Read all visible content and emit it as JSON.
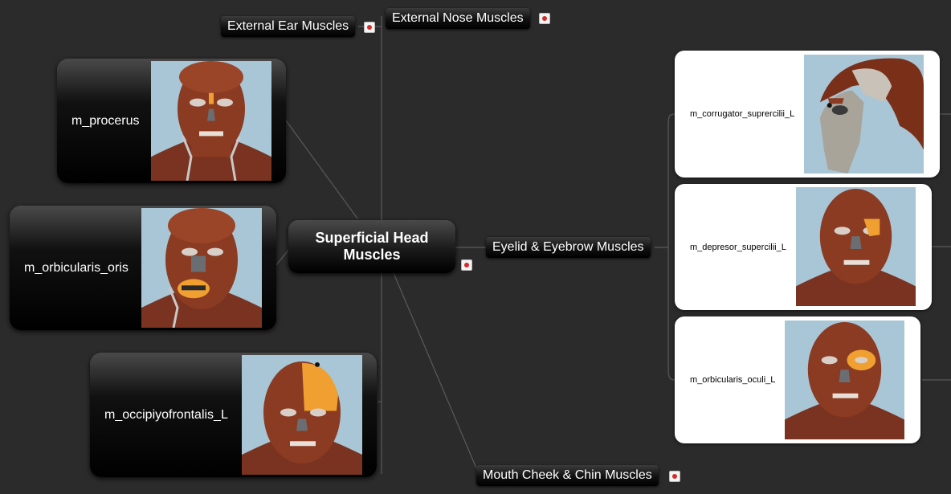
{
  "map": {
    "central_topic": "Superficial Head\nMuscles",
    "topics": {
      "external_ear": "External Ear Muscles",
      "external_nose": "External Nose Muscles",
      "eyelid_eyebrow": "Eyelid & Eyebrow Muscles",
      "mouth_cheek_chin": "Mouth Cheek & Chin Muscles"
    },
    "left_cards": [
      {
        "label": "m_procerus",
        "highlight": "nose-bridge"
      },
      {
        "label": "m_orbicularis_oris",
        "highlight": "lips"
      },
      {
        "label": "m_occipiyofrontalis_L",
        "highlight": "scalp"
      }
    ],
    "right_cards": [
      {
        "label": "m_corrugator_suprercilii_L",
        "highlight": "corrugator"
      },
      {
        "label": "m_depresor_supercilii_L",
        "highlight": "eyebrow"
      },
      {
        "label": "m_orbicularis_oculi_L",
        "highlight": "eye-ring"
      }
    ],
    "icons": {
      "note": "attachment-note-icon"
    }
  },
  "colors": {
    "background": "#2b2b2b",
    "muscle": "#8a3b22",
    "highlight": "#f0a030",
    "image_bg": "#a9c6d6"
  }
}
